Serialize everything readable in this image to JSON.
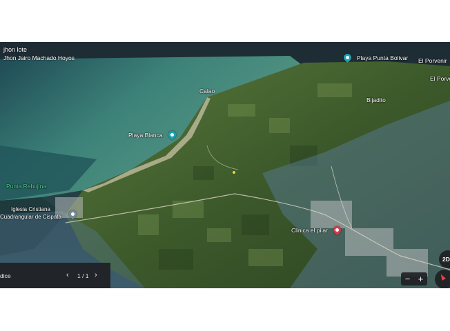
{
  "map": {
    "title": "jhon lote",
    "subtitle": "Jhon Jairo Machado Hoyos",
    "labels": {
      "playa_punta_bolivar": "Playa Punta Bolivar",
      "el_porvenir_1": "El Porvenir",
      "el_porvenir_2": "El Porvenir",
      "calao": "Calao",
      "bijadito": "Bijadito",
      "playa_blanca": "Playa Blanca",
      "punta_rebujina": "Punta Rebujina",
      "iglesia_line1": "Iglesia Cristiana",
      "iglesia_line2": "Cuadrangular de Cispatá",
      "clinica": "Clinica el pilar"
    },
    "icons": {
      "beach_pin": "beach-pin-icon",
      "church_pin": "church-pin-icon",
      "hospital_pin": "hospital-pin-icon",
      "placemark": "placemark-icon"
    },
    "colors": {
      "sea": "#3f7f7a",
      "land": "#3b5a2a",
      "overlay": "#4e6f8f",
      "beach_pin": "#1aa3b3",
      "hospital_pin": "#d93a4b",
      "label_green": "#4fd38a"
    }
  },
  "bottom_bar": {
    "label": "dice",
    "prev_icon": "‹",
    "count": "1 / 1",
    "next_icon": "›"
  },
  "controls": {
    "zoom_out": "−",
    "zoom_in": "+",
    "view_2d": "2D"
  }
}
